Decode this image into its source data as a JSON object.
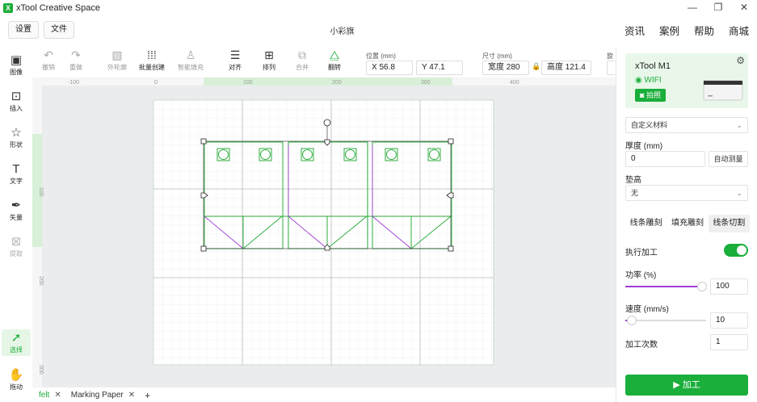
{
  "app": {
    "title": "xTool Creative Space",
    "logo": "X"
  },
  "window": {
    "minimize": "—",
    "restore": "❐",
    "close": "✕"
  },
  "menubar": {
    "settings": "设置",
    "file": "文件",
    "doc_title": "小彩旗",
    "links": [
      "资讯",
      "案例",
      "帮助",
      "商城"
    ]
  },
  "toolbar": {
    "undo": "撤销",
    "redo": "重做",
    "outline": "外轮廓",
    "batch_create": "批量创建",
    "smart_fill": "智能填充",
    "align": "对齐",
    "arrange": "排列",
    "combine": "合并",
    "flip": "翻转",
    "position_label": "位置 (mm)",
    "x_value": "X  56.8",
    "y_value": "Y  47.1",
    "size_label": "尺寸 (mm)",
    "width_value": "宽度  280",
    "height_value": "高度  121.4",
    "rotate_label": "旋"
  },
  "leftbar": {
    "items": [
      {
        "label": "图像",
        "icon": "image-icon"
      },
      {
        "label": "插入",
        "icon": "insert-icon"
      },
      {
        "label": "形状",
        "icon": "shape-icon"
      },
      {
        "label": "文字",
        "icon": "text-icon"
      },
      {
        "label": "矢量",
        "icon": "vector-icon"
      },
      {
        "label": "提取",
        "icon": "extract-icon"
      },
      {
        "label": "选择",
        "icon": "select-icon"
      },
      {
        "label": "拖动",
        "icon": "hand-icon"
      }
    ]
  },
  "ruler": {
    "h_ticks": [
      "-100",
      "0",
      "100",
      "200",
      "300",
      "400"
    ],
    "v_ticks": [
      "100",
      "200",
      "300"
    ]
  },
  "tabs": [
    {
      "name": "felt",
      "close": "✕"
    },
    {
      "name": "Marking Paper",
      "close": "✕"
    }
  ],
  "tab_add": "+",
  "device": {
    "name": "xTool M1",
    "wifi": "WIFI",
    "photo": "拍照"
  },
  "material": {
    "selected": "自定义材料"
  },
  "thickness": {
    "label": "厚度 (mm)",
    "value": "0",
    "auto_measure": "自动测量"
  },
  "raise": {
    "label": "垫高",
    "selected": "无"
  },
  "modes": {
    "tabs": [
      "线条雕刻",
      "填充雕刻",
      "线条切割"
    ],
    "active_index": 2
  },
  "execute": {
    "label": "执行加工",
    "enabled": true
  },
  "power": {
    "label": "功率 (%)",
    "value": "100",
    "fraction": 0.95
  },
  "speed": {
    "label": "速度 (mm/s)",
    "value": "10",
    "fraction": 0.08
  },
  "passes": {
    "label": "加工次数",
    "value": "1"
  },
  "process_button": "加工",
  "colors": {
    "accent": "#1aae3a",
    "slider": "#a13cd6"
  }
}
